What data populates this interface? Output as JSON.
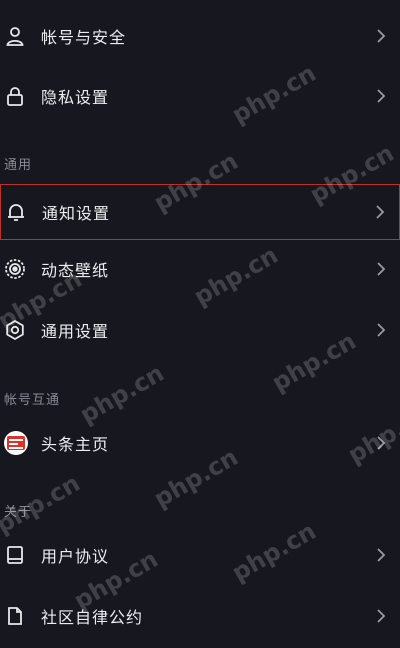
{
  "rows": [
    {
      "label": "帐号与安全",
      "icon": "user-icon"
    },
    {
      "label": "隐私设置",
      "icon": "lock-icon"
    },
    {
      "label": "通知设置",
      "icon": "bell-icon"
    },
    {
      "label": "动态壁纸",
      "icon": "wallpaper-icon"
    },
    {
      "label": "通用设置",
      "icon": "gear-icon"
    },
    {
      "label": "头条主页",
      "icon": "toutiao-app-icon"
    },
    {
      "label": "用户协议",
      "icon": "book-icon"
    },
    {
      "label": "社区自律公约",
      "icon": "document-icon"
    }
  ],
  "sections": {
    "general": "通用",
    "account_link": "帐号互通",
    "about": "关于"
  },
  "watermark_text": "php.cn",
  "colors": {
    "background": "#17171f",
    "highlight_border": "#c0302b",
    "section_text": "#8a8a95",
    "toutiao_red": "#d8342c"
  }
}
